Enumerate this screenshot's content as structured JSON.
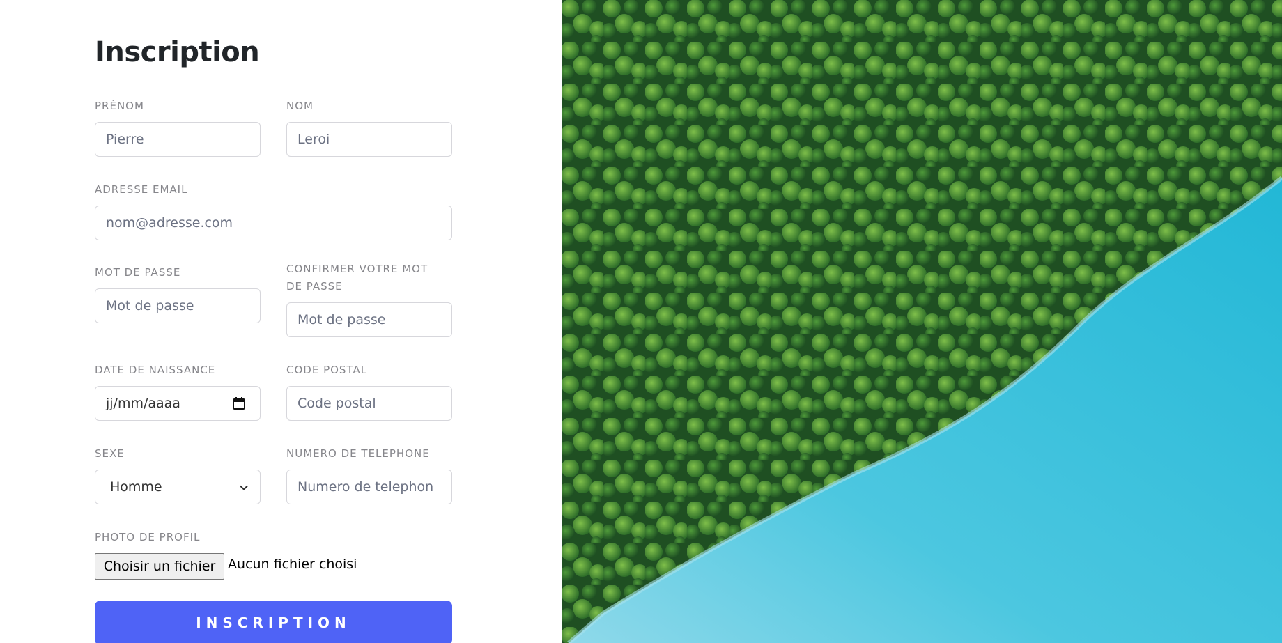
{
  "form": {
    "title": "Inscription",
    "first_name": {
      "label": "PRÉNOM",
      "placeholder": "Pierre"
    },
    "last_name": {
      "label": "NOM",
      "placeholder": "Leroi"
    },
    "email": {
      "label": "ADRESSE EMAIL",
      "placeholder": "nom@adresse.com"
    },
    "password": {
      "label": "MOT DE PASSE",
      "placeholder": "Mot de passe"
    },
    "confirm_password": {
      "label_line1": "CONFIRMER VOTRE MOT",
      "label_line2": "DE PASSE",
      "placeholder": "Mot de passe"
    },
    "birth_date": {
      "label": "DATE DE NAISSANCE",
      "value": "jj/mm/aaaa",
      "icon": "calendar-icon"
    },
    "postal_code": {
      "label": "CODE POSTAL",
      "placeholder": "Code postal"
    },
    "gender": {
      "label": "SEXE",
      "selected": "Homme",
      "icon": "chevron-down-icon"
    },
    "phone": {
      "label": "NUMERO DE TELEPHONE",
      "placeholder": "Numero de telephon"
    },
    "photo": {
      "label": "PHOTO DE PROFIL",
      "button": "Choisir un fichier",
      "status": "Aucun fichier choisi"
    },
    "submit": "INSCRIPTION"
  },
  "colors": {
    "accent": "#4f63f6",
    "label": "#86868b",
    "forest": "#2d6b2a",
    "water": "#3ec4dd"
  }
}
